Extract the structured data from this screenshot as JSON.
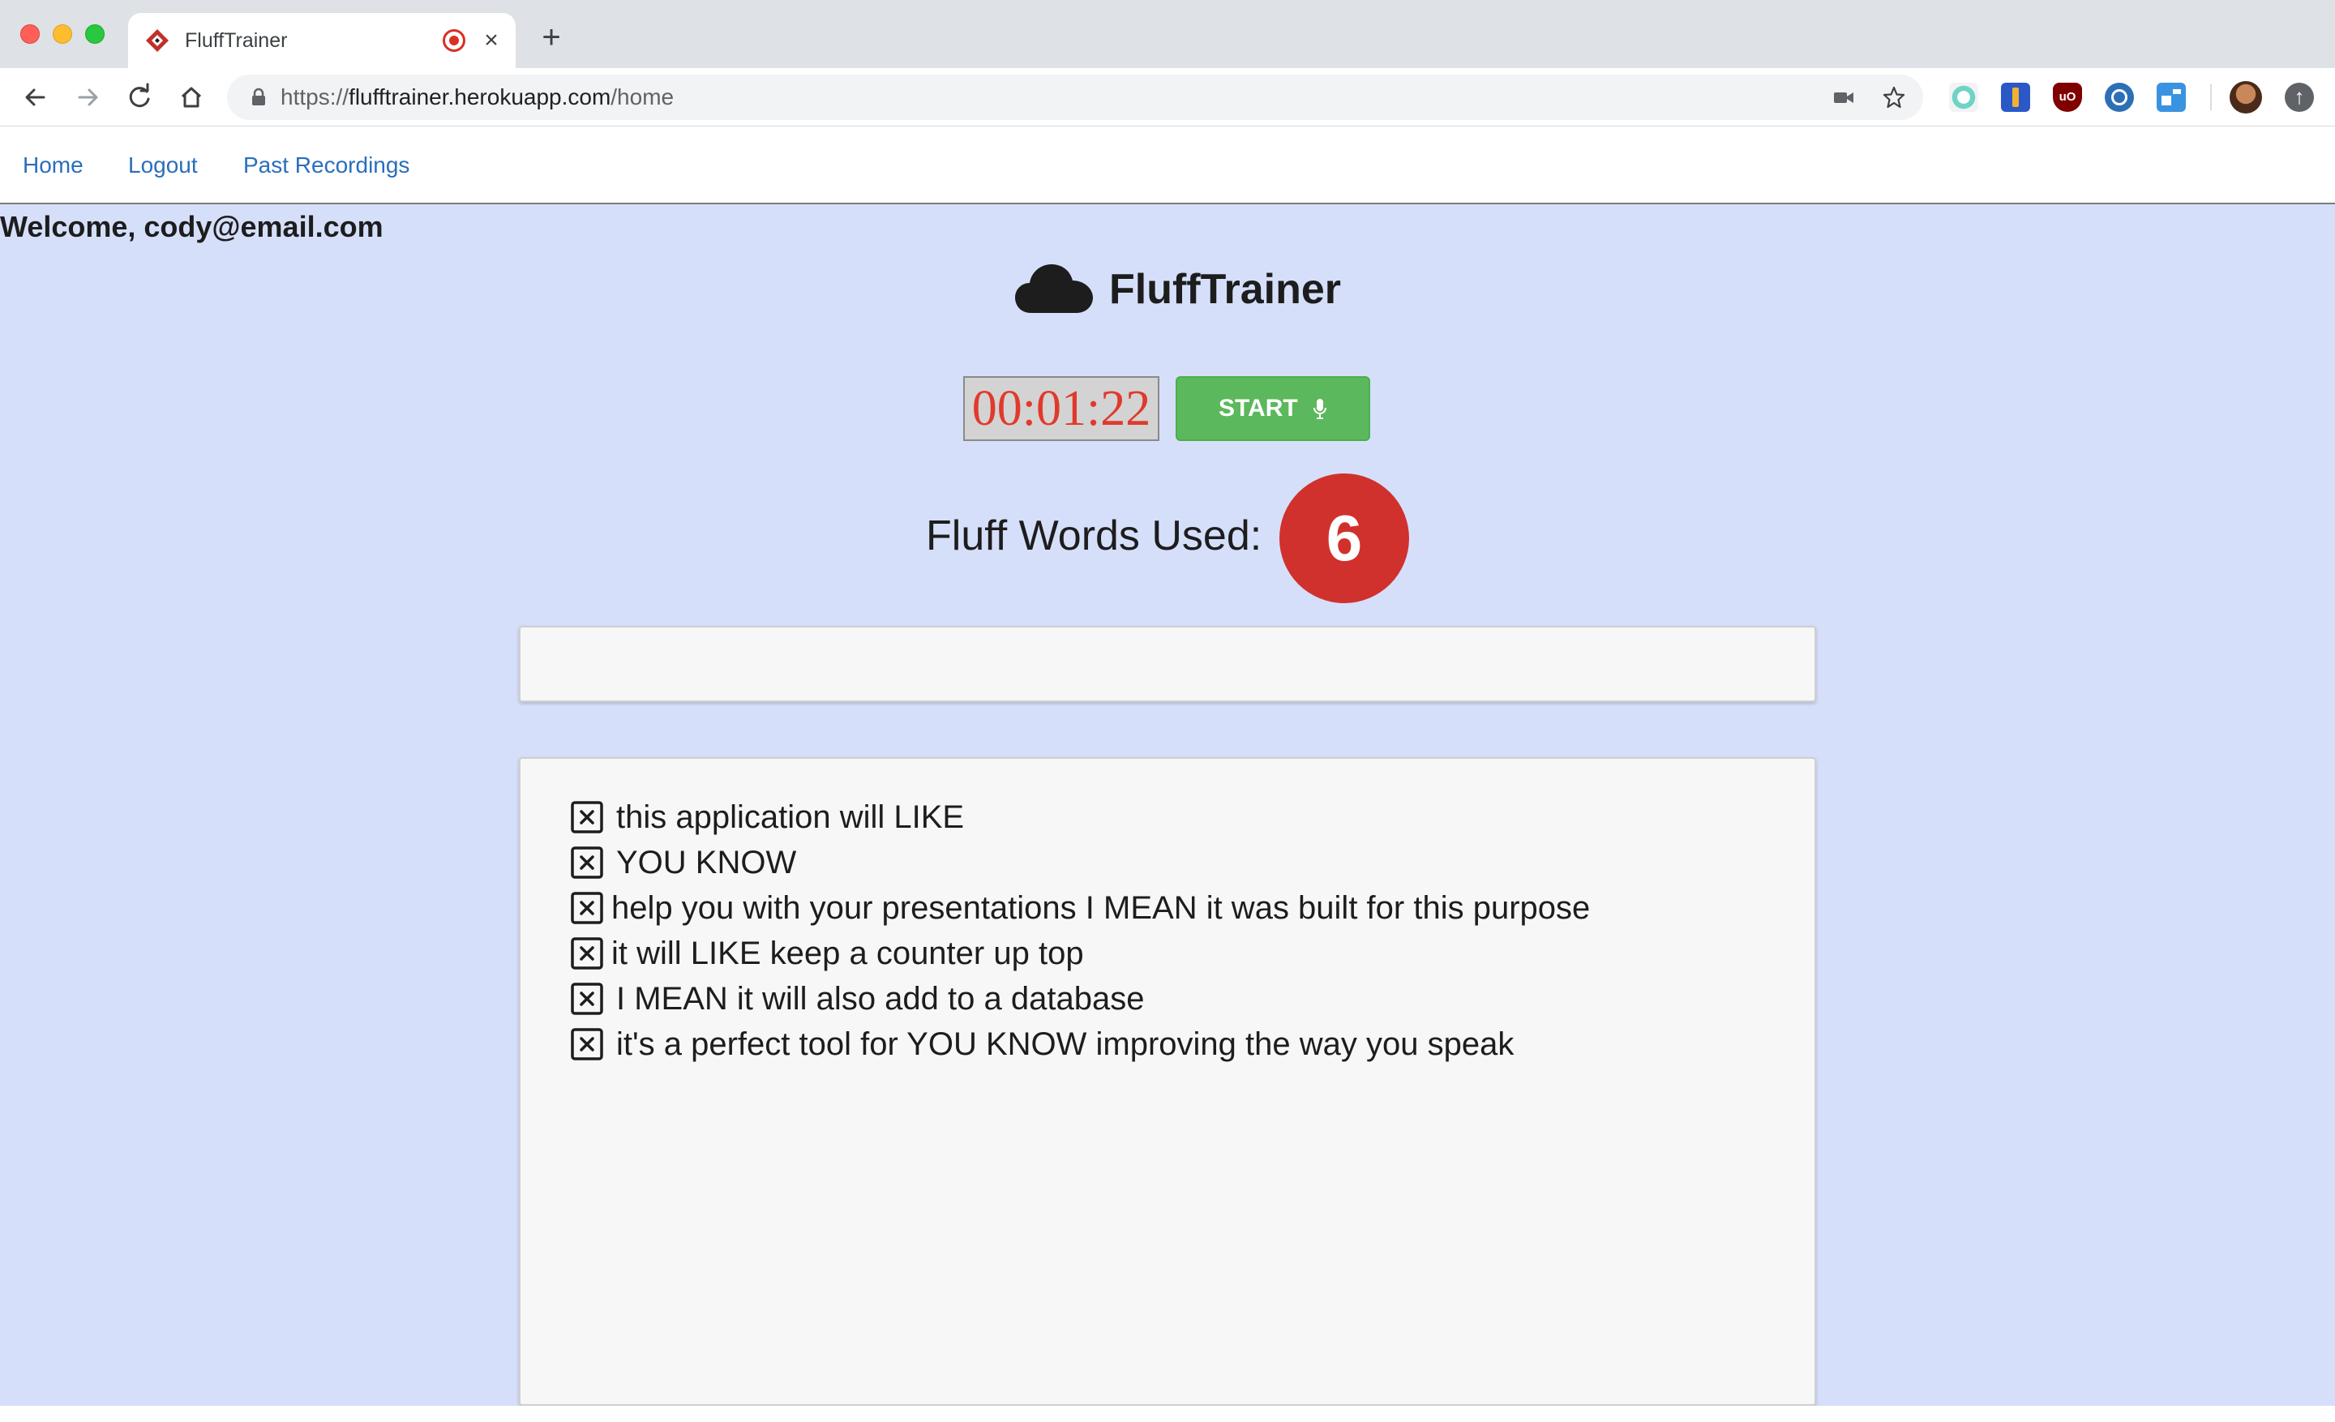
{
  "browser": {
    "tab_title": "FluffTrainer",
    "new_tab_symbol": "+",
    "close_symbol": "×",
    "url_prefix": "https://",
    "url_host": "flufftrainer.herokuapp.com",
    "url_path": "/home",
    "icons": {
      "back": "back-arrow-icon",
      "forward": "forward-arrow-icon",
      "reload": "reload-icon",
      "home": "home-icon",
      "lock": "lock-icon",
      "camera": "camera-icon",
      "bookmark": "star-icon",
      "update": "update-arrow-icon"
    },
    "extensions": [
      "extension-1-icon",
      "extension-2-icon",
      "ublock-icon",
      "extension-4-icon",
      "extension-5-icon"
    ]
  },
  "nav": {
    "home": "Home",
    "logout": "Logout",
    "past_recordings": "Past Recordings"
  },
  "welcome": "Welcome, cody@email.com",
  "brand": {
    "title": "FluffTrainer",
    "icon": "cloud-icon"
  },
  "recorder": {
    "timer": "00:01:22",
    "start_label": "START",
    "mic_icon": "microphone-icon"
  },
  "fluff": {
    "label": "Fluff Words Used:",
    "count": "6"
  },
  "live_transcript": "",
  "transcript_lines": [
    "this application will LIKE",
    "YOU KNOW",
    "help you with your presentations I MEAN it was built for this purpose",
    "it will LIKE keep a counter up top",
    "I MEAN it will also add to a database",
    "it's a perfect tool for YOU KNOW improving the way you speak"
  ],
  "colors": {
    "page_background": "#d6dffa",
    "start_button": "#5cb85c",
    "fluff_badge": "#d0312d",
    "timer_text": "#e03a2c",
    "link": "#2a6ebb"
  }
}
